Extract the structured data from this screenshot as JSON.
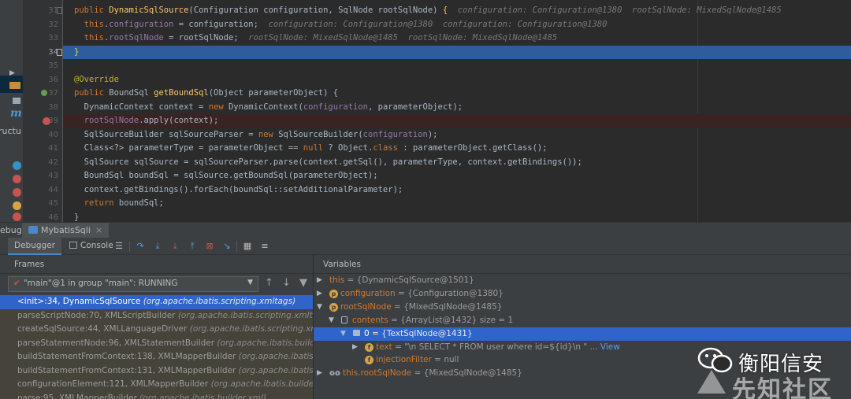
{
  "editor": {
    "lines": [
      {
        "num": "31",
        "segments": [
          {
            "t": "public ",
            "c": "kw"
          },
          {
            "t": "DynamicSqlSource",
            "c": "fn"
          },
          {
            "t": "(Configuration configuration, SqlNode rootSqlNode) ",
            "c": ""
          },
          {
            "t": "{",
            "c": "fn"
          },
          {
            "t": "  configuration: Configuration@1380  rootSqlNode: MixedSqlNode@1485",
            "c": "hint"
          }
        ]
      },
      {
        "num": "32",
        "segments": [
          {
            "t": "  this",
            "c": "kw"
          },
          {
            "t": ".",
            "c": ""
          },
          {
            "t": "configuration",
            "c": "fd"
          },
          {
            "t": " = configuration;  ",
            "c": ""
          },
          {
            "t": "configuration: Configuration@1380  configuration: Configuration@1380",
            "c": "hint"
          }
        ]
      },
      {
        "num": "33",
        "segments": [
          {
            "t": "  this",
            "c": "kw"
          },
          {
            "t": ".",
            "c": ""
          },
          {
            "t": "rootSqlNode",
            "c": "fd"
          },
          {
            "t": " = rootSqlNode;  ",
            "c": ""
          },
          {
            "t": "rootSqlNode: MixedSqlNode@1485  rootSqlNode: MixedSqlNode@1485",
            "c": "hint"
          }
        ]
      },
      {
        "num": "34",
        "segments": [
          {
            "t": "}",
            "c": "fn"
          }
        ]
      },
      {
        "num": "35",
        "segments": []
      },
      {
        "num": "36",
        "segments": [
          {
            "t": "@Override",
            "c": "an"
          }
        ]
      },
      {
        "num": "37",
        "segments": [
          {
            "t": "public ",
            "c": "kw"
          },
          {
            "t": "BoundSql ",
            "c": ""
          },
          {
            "t": "getBoundSql",
            "c": "fn"
          },
          {
            "t": "(Object parameterObject) {",
            "c": ""
          }
        ]
      },
      {
        "num": "38",
        "segments": [
          {
            "t": "  DynamicContext context = ",
            "c": ""
          },
          {
            "t": "new ",
            "c": "kw"
          },
          {
            "t": "DynamicContext(",
            "c": ""
          },
          {
            "t": "configuration",
            "c": "fd"
          },
          {
            "t": ", parameterObject);",
            "c": ""
          }
        ]
      },
      {
        "num": "39",
        "segments": [
          {
            "t": "  rootSqlNode",
            "c": "fd"
          },
          {
            "t": ".apply(context);",
            "c": ""
          }
        ]
      },
      {
        "num": "40",
        "segments": [
          {
            "t": "  SqlSourceBuilder sqlSourceParser = ",
            "c": ""
          },
          {
            "t": "new ",
            "c": "kw"
          },
          {
            "t": "SqlSourceBuilder(",
            "c": ""
          },
          {
            "t": "configuration",
            "c": "fd"
          },
          {
            "t": ");",
            "c": ""
          }
        ]
      },
      {
        "num": "41",
        "segments": [
          {
            "t": "  Class<?> parameterType = parameterObject == ",
            "c": ""
          },
          {
            "t": "null",
            "c": "kw"
          },
          {
            "t": " ? Object.",
            "c": ""
          },
          {
            "t": "class",
            "c": "kw"
          },
          {
            "t": " : parameterObject.getClass();",
            "c": ""
          }
        ]
      },
      {
        "num": "42",
        "segments": [
          {
            "t": "  SqlSource sqlSource = sqlSourceParser.parse(context.getSql(), parameterType, context.getBindings());",
            "c": ""
          }
        ]
      },
      {
        "num": "43",
        "segments": [
          {
            "t": "  BoundSql boundSql = sqlSource.getBoundSql(parameterObject);",
            "c": ""
          }
        ]
      },
      {
        "num": "44",
        "segments": [
          {
            "t": "  context.getBindings().forEach(boundSql::setAdditionalParameter);",
            "c": ""
          }
        ]
      },
      {
        "num": "45",
        "segments": [
          {
            "t": "  ",
            "c": ""
          },
          {
            "t": "return ",
            "c": "kw"
          },
          {
            "t": "boundSql;",
            "c": ""
          }
        ]
      },
      {
        "num": "46",
        "segments": [
          {
            "t": "}",
            "c": ""
          }
        ]
      }
    ]
  },
  "left_strip": {
    "structure_label": "ructu"
  },
  "debug": {
    "side_label": "ebug:",
    "session_tab": "MybatisSqli",
    "close_glyph": "×",
    "tabs": {
      "debugger": "Debugger",
      "console": "Console"
    },
    "toolbar_icons": [
      "layout-icon",
      "step-over-icon",
      "step-into-icon",
      "force-step-into-icon",
      "step-out-icon",
      "drop-frame-icon",
      "run-to-cursor-icon",
      "evaluate-icon",
      "trace-icon",
      "settings-icon"
    ]
  },
  "frames": {
    "header": "Frames",
    "thread": "\"main\"@1 in group \"main\": RUNNING",
    "items": [
      {
        "method": "<init>:34, DynamicSqlSource ",
        "pkg": "(org.apache.ibatis.scripting.xmltags)"
      },
      {
        "method": "parseScriptNode:70, XMLScriptBuilder ",
        "pkg": "(org.apache.ibatis.scripting.xmltags)"
      },
      {
        "method": "createSqlSource:44, XMLLanguageDriver ",
        "pkg": "(org.apache.ibatis.scripting.xmltags)"
      },
      {
        "method": "parseStatementNode:96, XMLStatementBuilder ",
        "pkg": "(org.apache.ibatis.builder.xml)"
      },
      {
        "method": "buildStatementFromContext:138, XMLMapperBuilder ",
        "pkg": "(org.apache.ibatis.builder.xml)"
      },
      {
        "method": "buildStatementFromContext:131, XMLMapperBuilder ",
        "pkg": "(org.apache.ibatis.builder.xml)"
      },
      {
        "method": "configurationElement:121, XMLMapperBuilder ",
        "pkg": "(org.apache.ibatis.builder.xml)"
      },
      {
        "method": "parse:95, XMLMapperBuilder ",
        "pkg": "(org.apache.ibatis.builder.xml)"
      }
    ]
  },
  "variables": {
    "header": "Variables",
    "rows": [
      {
        "arrow": "▶",
        "icon": "",
        "icon_char": "",
        "name": "this",
        "value": " = {DynamicSqlSource@1501}",
        "link": "",
        "indent": 0
      },
      {
        "arrow": "▶",
        "icon": "p",
        "icon_char": "p",
        "name": "configuration",
        "value": " = {Configuration@1380}",
        "link": "",
        "indent": 0
      },
      {
        "arrow": "▼",
        "icon": "p",
        "icon_char": "p",
        "name": "rootSqlNode",
        "value": " = {MixedSqlNode@1485}",
        "link": "",
        "indent": 0
      },
      {
        "arrow": "▼",
        "icon": "field",
        "icon_char": "",
        "name": "contents",
        "value": " = {ArrayList@1432}  size = 1",
        "link": "",
        "indent": 1
      },
      {
        "arrow": "▼",
        "icon": "list",
        "icon_char": "",
        "name": "0",
        "value": " = {TextSqlNode@1431}",
        "link": "",
        "indent": 2
      },
      {
        "arrow": "▶",
        "icon": "f",
        "icon_char": "f",
        "name": "text",
        "value": " = \"\\n        SELECT * FROM user where id=${id}\\n    \" ... ",
        "link": "View",
        "indent": 3
      },
      {
        "arrow": "",
        "icon": "f",
        "icon_char": "f",
        "name": "injectionFilter",
        "value": " = null",
        "link": "",
        "indent": 3
      },
      {
        "arrow": "▶",
        "icon": "oo",
        "icon_char": "oo",
        "name": "this.rootSqlNode",
        "value": " = {MixedSqlNode@1485}",
        "link": "",
        "indent": 0
      }
    ]
  },
  "watermark": {
    "title": "衡阳信安",
    "subtitle": "先知社区"
  }
}
